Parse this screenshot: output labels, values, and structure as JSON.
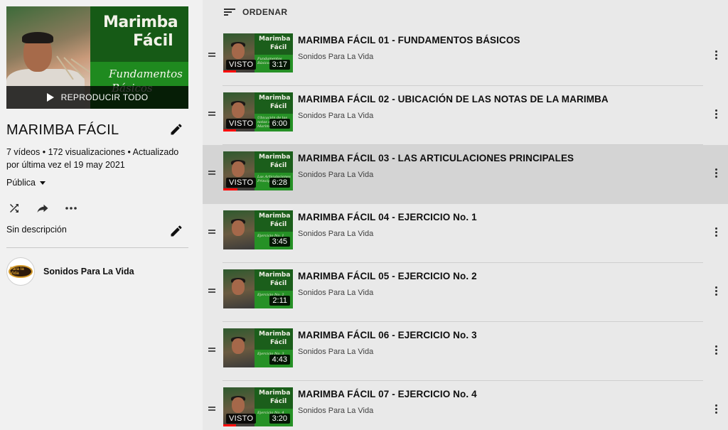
{
  "playlist": {
    "hero": {
      "brand_line1": "Marimba",
      "brand_line2": "Fácil",
      "subtitle_line1": "Fundamentos",
      "subtitle_line2": "Básicos",
      "play_all_label": "REPRODUCIR TODO"
    },
    "title": "MARIMBA FÁCIL",
    "stats": "7 vídeos • 172 visualizaciones • Actualizado por última vez el 19 may 2021",
    "privacy": "Pública",
    "description": "Sin descripción",
    "owner": {
      "name": "Sonidos Para La Vida",
      "avatar_text": "Para la Vida"
    },
    "actions": [
      "shuffle-icon",
      "share-icon",
      "more-horizontal-icon"
    ]
  },
  "list": {
    "sort_label": "ORDENAR",
    "seen_label": "VISTO",
    "videos": [
      {
        "title": "MARIMBA FÁCIL 01 - FUNDAMENTOS BÁSICOS",
        "channel": "Sonidos Para La Vida",
        "duration": "3:17",
        "watched": true,
        "thumb_brand1": "Marimba",
        "thumb_brand2": "Fácil",
        "thumb_caption": "Fundamentos Básicos",
        "active": false
      },
      {
        "title": "MARIMBA FÁCIL 02 - UBICACIÓN DE LAS NOTAS DE LA MARIMBA",
        "channel": "Sonidos Para La Vida",
        "duration": "6:00",
        "watched": true,
        "thumb_brand1": "Marimba",
        "thumb_brand2": "Fácil",
        "thumb_caption": "Ubicación de las notas en la Marimba",
        "active": false
      },
      {
        "title": "MARIMBA FÁCIL 03 - LAS ARTICULACIONES PRINCIPALES",
        "channel": "Sonidos Para La Vida",
        "duration": "6:28",
        "watched": true,
        "thumb_brand1": "Marimba",
        "thumb_brand2": "Fácil",
        "thumb_caption": "Las Articulaciones Principales",
        "active": true
      },
      {
        "title": "MARIMBA FÁCIL 04 - EJERCICIO No. 1",
        "channel": "Sonidos Para La Vida",
        "duration": "3:45",
        "watched": false,
        "thumb_brand1": "Marimba",
        "thumb_brand2": "Fácil",
        "thumb_caption": "Ejercicio No. 1",
        "active": false
      },
      {
        "title": "MARIMBA FÁCIL 05 - EJERCICIO No. 2",
        "channel": "Sonidos Para La Vida",
        "duration": "2:11",
        "watched": false,
        "thumb_brand1": "Marimba",
        "thumb_brand2": "Fácil",
        "thumb_caption": "Ejercicio No. 2",
        "active": false
      },
      {
        "title": "MARIMBA FÁCIL 06 - EJERCICIO No. 3",
        "channel": "Sonidos Para La Vida",
        "duration": "4:43",
        "watched": false,
        "thumb_brand1": "Marimba",
        "thumb_brand2": "Fácil",
        "thumb_caption": "Ejercicio No. 3",
        "active": false
      },
      {
        "title": "MARIMBA FÁCIL 07 - EJERCICIO No. 4",
        "channel": "Sonidos Para La Vida",
        "duration": "3:20",
        "watched": true,
        "thumb_brand1": "Marimba",
        "thumb_brand2": "Fácil",
        "thumb_caption": "Ejercicio No. 4",
        "active": false
      }
    ]
  },
  "colors": {
    "accent_red": "#ff0000",
    "brand_green_dark": "#165a16",
    "brand_green_light": "#1f8a1f",
    "active_row_bg": "#d4d4d4"
  }
}
